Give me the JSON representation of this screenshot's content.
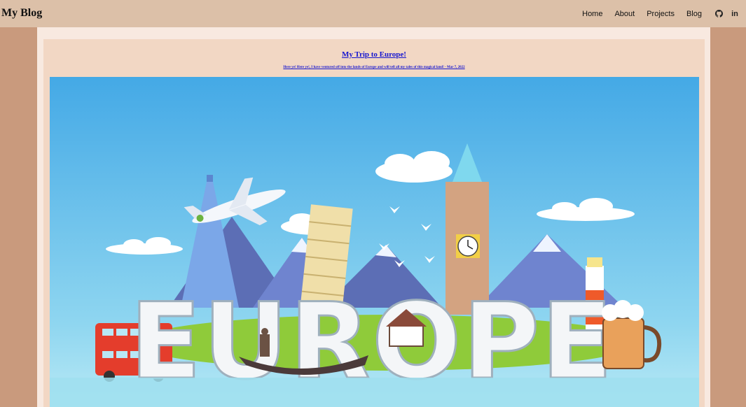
{
  "nav": {
    "brand": "My Blog",
    "links": [
      "Home",
      "About",
      "Projects",
      "Blog"
    ],
    "icons": [
      "github-icon",
      "linkedin-icon"
    ],
    "linkedin_glyph": "in"
  },
  "post": {
    "title": "My Trip to Europe!",
    "subtitle": "Here ye! Here ye!, I have ventured off into the lands of Europe and will tell all my tales of this magical land! - Mar 7, 2022",
    "hero_word": "EUROPE"
  },
  "colors": {
    "nav_bg": "#dcc0a8",
    "page_bg": "#c99a7d",
    "link": "#1515d0",
    "sky": "#44a9e6"
  }
}
